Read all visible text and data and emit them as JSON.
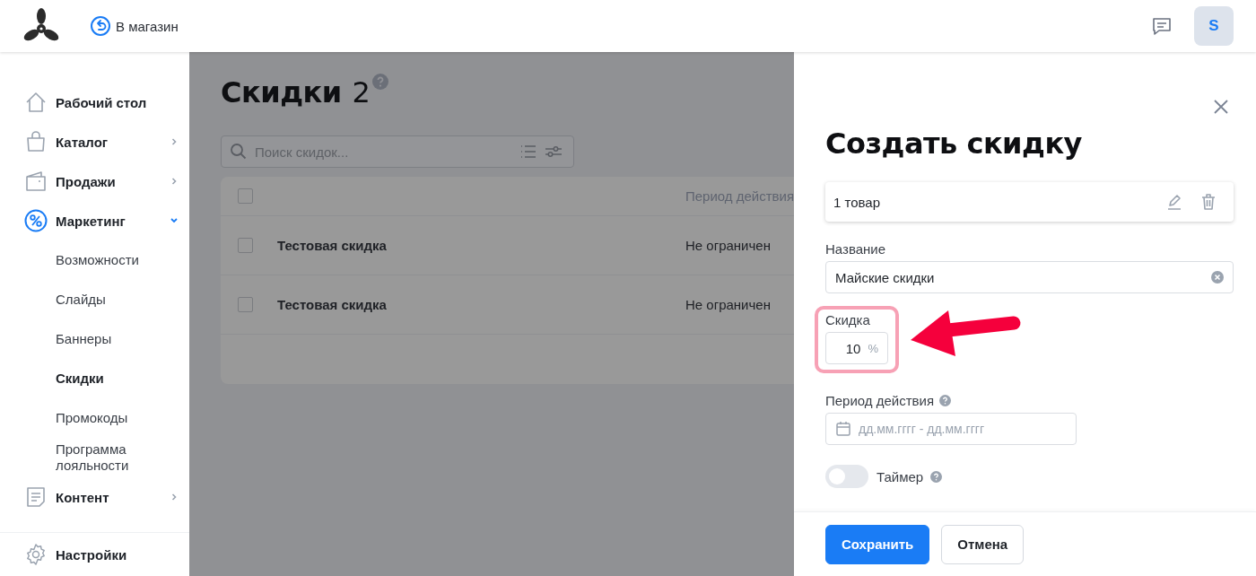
{
  "header": {
    "back_link": "В магазин",
    "avatar": "S"
  },
  "sidebar": {
    "items": [
      {
        "label": "Рабочий стол",
        "has_children": false,
        "expanded": false,
        "selected": false
      },
      {
        "label": "Каталог",
        "has_children": true,
        "expanded": false,
        "selected": false
      },
      {
        "label": "Продажи",
        "has_children": true,
        "expanded": false,
        "selected": false
      },
      {
        "label": "Маркетинг",
        "has_children": true,
        "expanded": true,
        "selected": true,
        "children": [
          {
            "label": "Возможности",
            "selected": false
          },
          {
            "label": "Слайды",
            "selected": false
          },
          {
            "label": "Баннеры",
            "selected": false
          },
          {
            "label": "Скидки",
            "selected": true
          },
          {
            "label": "Промокоды",
            "selected": false
          },
          {
            "label": "Программа лояльности",
            "selected": false
          }
        ]
      },
      {
        "label": "Контент",
        "has_children": true,
        "expanded": false,
        "selected": false
      }
    ],
    "settings": "Настройки"
  },
  "main": {
    "title": "Скидки",
    "count": "2",
    "search": {
      "placeholder": "Поиск скидок..."
    },
    "table": {
      "columns": [
        "Период действия"
      ],
      "all_checked": false,
      "rows": [
        {
          "name": "Тестовая скидка",
          "period": "Не ограничен",
          "checked": false
        },
        {
          "name": "Тестовая скидка",
          "period": "Не ограничен",
          "checked": false
        }
      ]
    }
  },
  "drawer": {
    "title": "Создать скидку",
    "product": "1 товар",
    "name_field": {
      "label": "Название",
      "value": "Майские скидки"
    },
    "discount_field": {
      "label": "Скидка",
      "value": "10",
      "unit": "%"
    },
    "period_field": {
      "label": "Период действия",
      "placeholder": "дд.мм.гггг - дд.мм.гггг"
    },
    "timer": {
      "label": "Таймер",
      "on": false
    },
    "buttons": {
      "save": "Сохранить",
      "cancel": "Отмена"
    }
  }
}
